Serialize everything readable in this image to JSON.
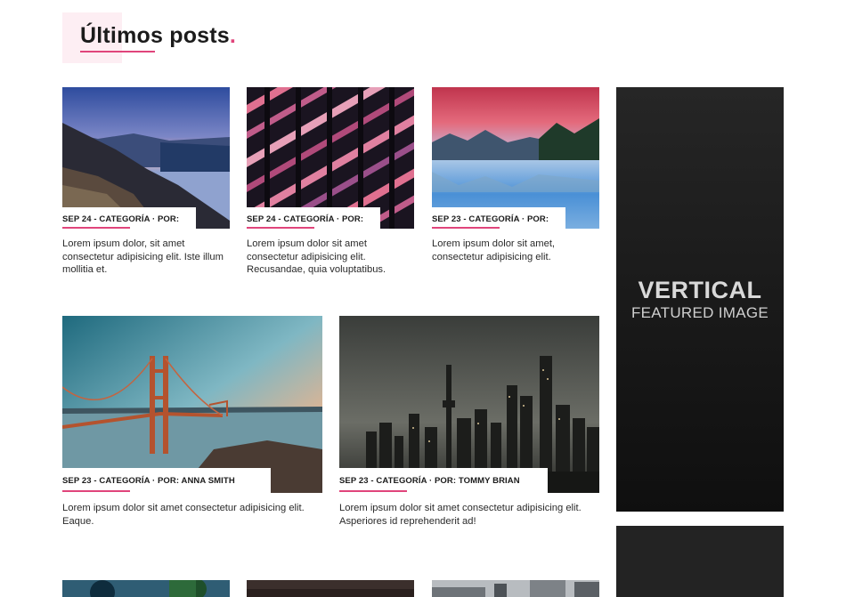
{
  "section": {
    "title": "Últimos posts",
    "title_dot": "."
  },
  "posts": [
    {
      "meta": "SEP 24 - CATEGORÍA · POR:",
      "excerpt": "Lorem ipsum dolor, sit amet consectetur adipisicing elit. Iste illum mollitia et.",
      "image": "mountain-sunset-image"
    },
    {
      "meta": "SEP 24 - CATEGORÍA · POR:",
      "excerpt": "Lorem ipsum dolor sit amet consectetur adipisicing elit. Recusandae, quia voluptatibus.",
      "image": "building-facade-image"
    },
    {
      "meta": "SEP 23 - CATEGORÍA · POR:",
      "excerpt": "Lorem ipsum dolor sit amet, consectetur adipisicing elit.",
      "image": "lake-mountains-image"
    },
    {
      "meta": "SEP 23 - CATEGORÍA · POR:  ANNA SMITH",
      "excerpt": "Lorem ipsum dolor sit amet consectetur adipisicing elit. Eaque.",
      "image": "golden-gate-bridge-image"
    },
    {
      "meta": "SEP 23 - CATEGORÍA · POR:  TOMMY BRIAN",
      "excerpt": "Lorem ipsum dolor sit amet consectetur adipisicing elit. Asperiores id reprehenderit ad!",
      "image": "city-skyline-image"
    }
  ],
  "sidebar": {
    "vertical_title": "VERTICAL",
    "vertical_subtitle": "FEATURED IMAGE"
  },
  "colors": {
    "accent": "#e0457b",
    "title_bg": "#fdeef3"
  }
}
